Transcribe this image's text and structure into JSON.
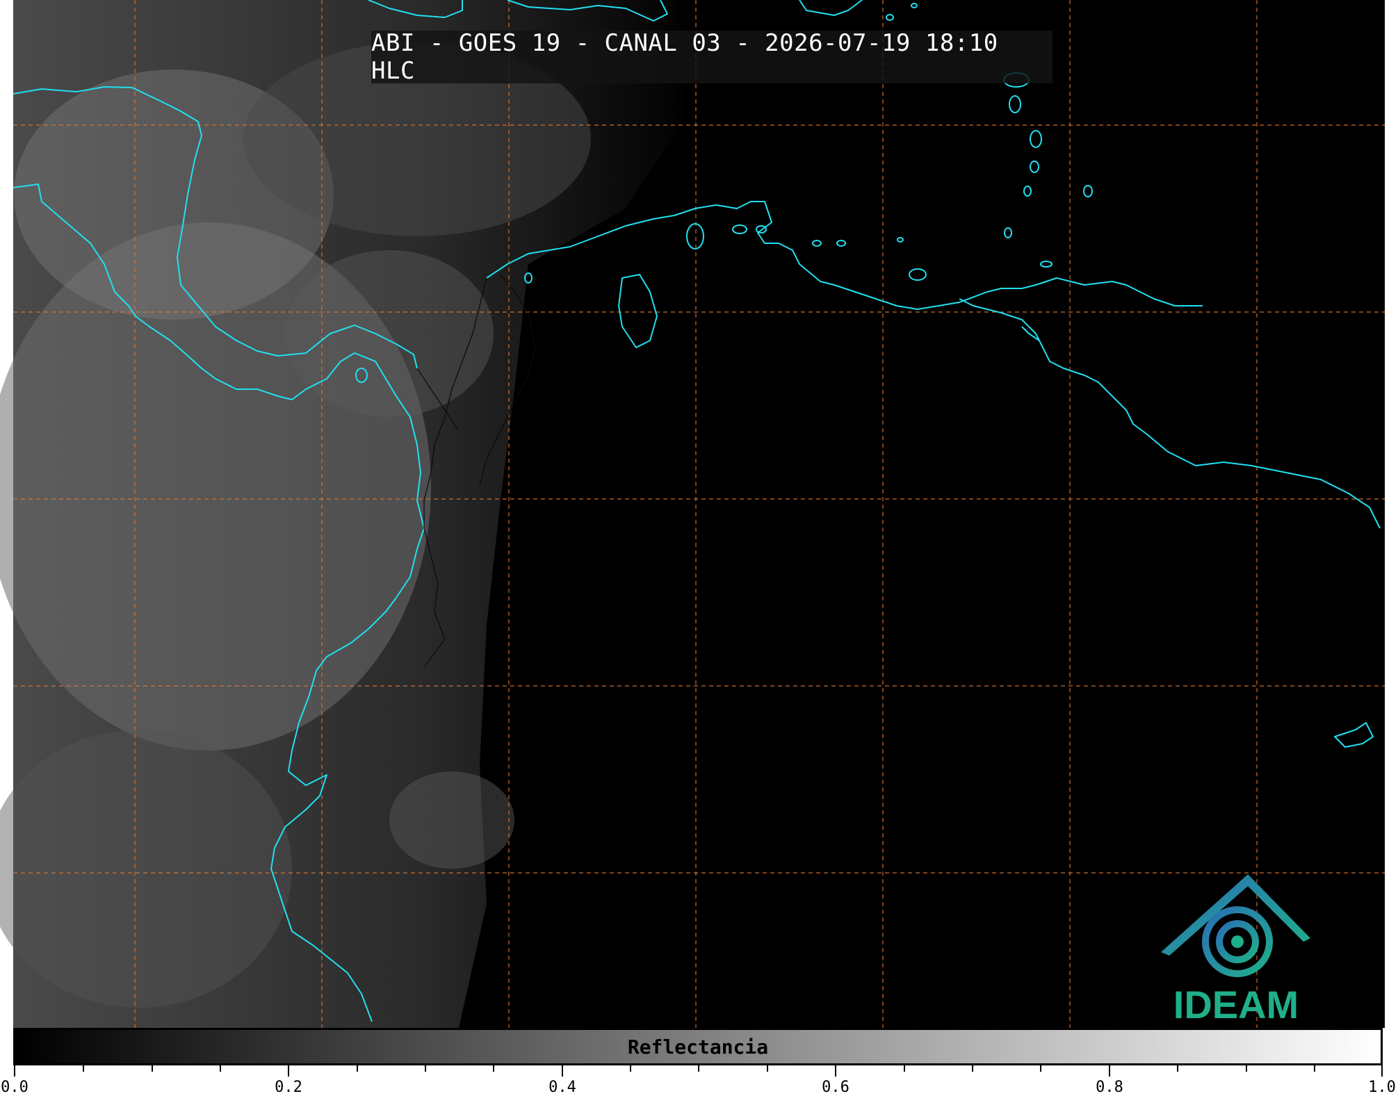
{
  "title": "ABI - GOES 19 - CANAL 03 - 2026-07-19 18:10 HLC",
  "colorbar": {
    "label": "Reflectancia",
    "range": [
      0.0,
      1.0
    ],
    "major_ticks": [
      "0.0",
      "0.2",
      "0.4",
      "0.6",
      "0.8",
      "1.0"
    ],
    "colors": {
      "low": "#000000",
      "high": "#ffffff"
    }
  },
  "logo": {
    "text": "IDEAM",
    "colors": {
      "primary": "#1fb08a",
      "secondary": "#2a6fb5"
    }
  },
  "map_style": {
    "coastline_color": "#22e0f0",
    "gridline_color": "#e07830",
    "background": "#000000"
  }
}
